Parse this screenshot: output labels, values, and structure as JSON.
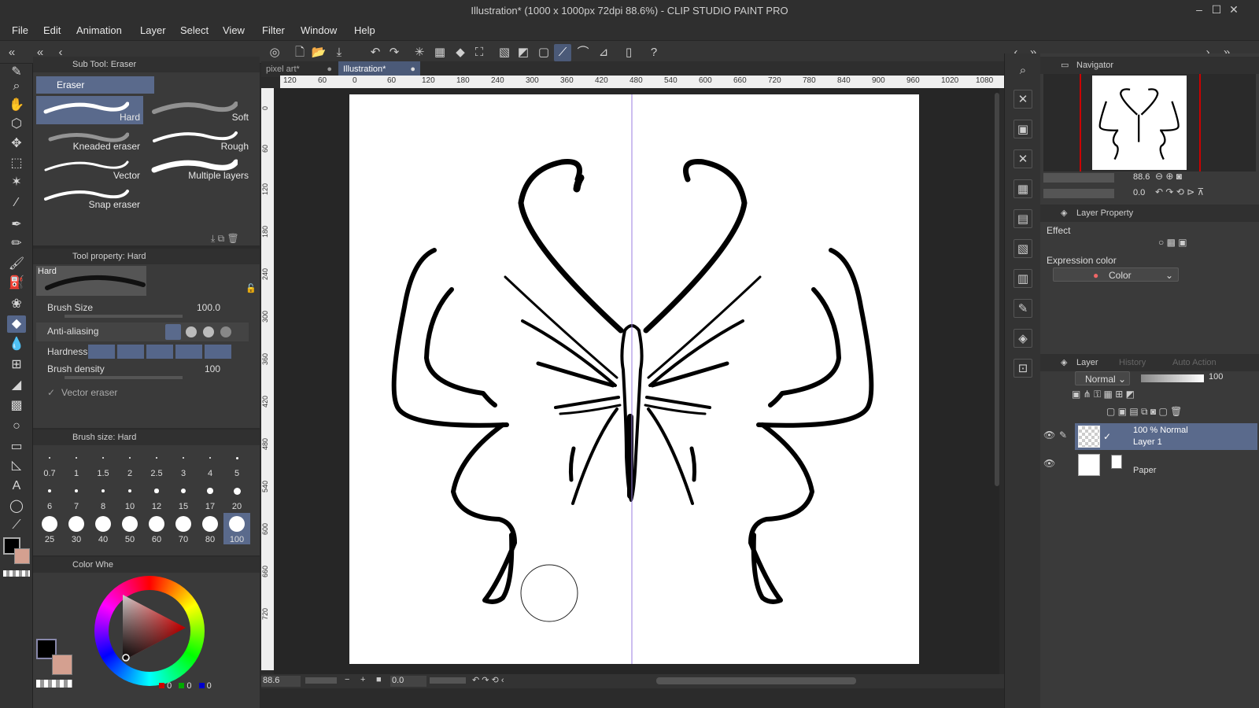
{
  "window": {
    "title": "Illustration* (1000 x 1000px 72dpi 88.6%) - CLIP STUDIO PAINT PRO"
  },
  "menu": [
    "File",
    "Edit",
    "Animation",
    "Layer",
    "Select",
    "View",
    "Filter",
    "Window",
    "Help"
  ],
  "subtool": {
    "header": "Sub Tool: Eraser",
    "group": "Eraser",
    "items": [
      "Hard",
      "Soft",
      "Kneaded eraser",
      "Rough",
      "Vector",
      "Multiple layers",
      "Snap eraser"
    ]
  },
  "tool_property": {
    "header": "Tool property: Hard",
    "preview_label": "Hard",
    "brush_size_label": "Brush Size",
    "brush_size_value": "100.0",
    "antialiasing_label": "Anti-aliasing",
    "hardness_label": "Hardness",
    "density_label": "Brush density",
    "density_value": "100",
    "vector_eraser_label": "Vector eraser"
  },
  "brush_size_panel": {
    "header": "Brush size: Hard",
    "sizes": [
      "0.7",
      "1",
      "1.5",
      "2",
      "2.5",
      "3",
      "4",
      "5",
      "6",
      "7",
      "8",
      "10",
      "12",
      "15",
      "17",
      "20",
      "25",
      "30",
      "40",
      "50",
      "60",
      "70",
      "80",
      "100"
    ],
    "selected": "100"
  },
  "color_panel": {
    "header": "Color Whe",
    "rgb": [
      "0",
      "0",
      "0"
    ],
    "main_color": "#000000",
    "sub_color": "#d4a090"
  },
  "tabs": [
    "pixel art*",
    "Illustration*"
  ],
  "ruler_h": [
    "120",
    "60",
    "0",
    "60",
    "120",
    "180",
    "240",
    "300",
    "360",
    "420",
    "480",
    "540",
    "600",
    "660",
    "720",
    "780",
    "840",
    "900",
    "960",
    "1020",
    "1080"
  ],
  "ruler_v": [
    "0",
    "60",
    "120",
    "180",
    "240",
    "300",
    "360",
    "420",
    "480",
    "540",
    "600",
    "660",
    "720"
  ],
  "status": {
    "zoom": "88.6",
    "rotation": "0.0"
  },
  "navigator": {
    "header": "Navigator",
    "zoom": "88.6",
    "rotation": "0.0"
  },
  "layer_property": {
    "header": "Layer Property",
    "effect_label": "Effect",
    "expression_label": "Expression color",
    "expression_value": "Color"
  },
  "layer_panel": {
    "tabs": [
      "Layer",
      "History",
      "Auto Action"
    ],
    "blend_mode": "Normal",
    "opacity": "100",
    "layers": [
      {
        "mode": "100 % Normal",
        "name": "Layer 1"
      },
      {
        "mode": "",
        "name": "Paper"
      }
    ]
  }
}
